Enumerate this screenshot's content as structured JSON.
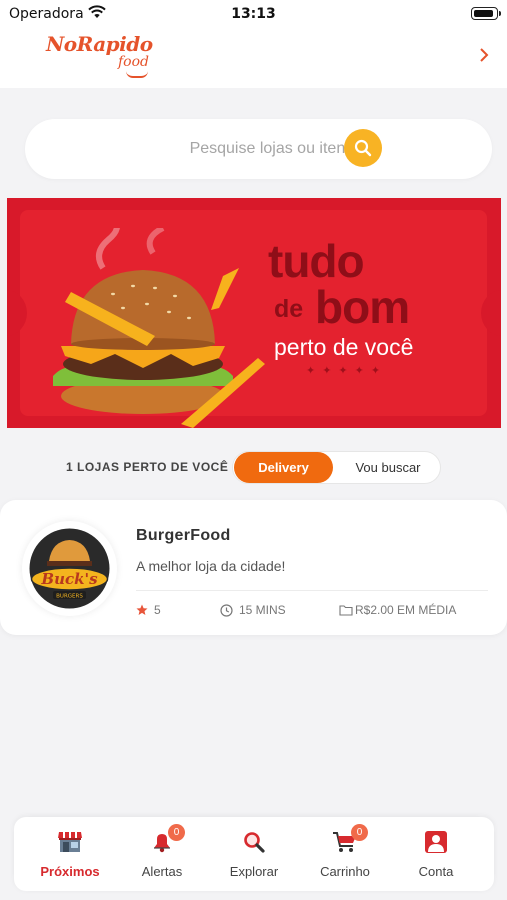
{
  "status_bar": {
    "carrier": "Operadora",
    "time": "13:13"
  },
  "header": {
    "logo_main": "NoRapido",
    "logo_sub": "food"
  },
  "search": {
    "placeholder": "Pesquise lojas ou itens ..."
  },
  "banner": {
    "line1": "tudo",
    "line2_small": "de",
    "line2_big": "bom",
    "line3": "perto de você"
  },
  "filter": {
    "stores_near": "1 LOJAS PERTO DE VOCÊ",
    "options": [
      "Delivery",
      "Vou buscar"
    ],
    "selected": "Delivery"
  },
  "stores": [
    {
      "name": "BurgerFood",
      "description": "A melhor loja da cidade!",
      "rating": "5",
      "time": "15 MINS",
      "price": "R$2.00 EM MÉDIA",
      "logo_text": "Buck's",
      "logo_sub": "BURGERS"
    }
  ],
  "tabbar": {
    "tabs": [
      {
        "label": "Próximos",
        "icon": "store-icon",
        "active": true
      },
      {
        "label": "Alertas",
        "icon": "bell-icon",
        "badge": "0"
      },
      {
        "label": "Explorar",
        "icon": "search-icon"
      },
      {
        "label": "Carrinho",
        "icon": "cart-icon",
        "badge": "0"
      },
      {
        "label": "Conta",
        "icon": "user-icon"
      }
    ]
  },
  "colors": {
    "accent_orange": "#f06a0f",
    "brand_red": "#e5532b",
    "search_button": "#f8b324",
    "banner_red": "#e4222f",
    "active_tab": "#d72a2e"
  }
}
